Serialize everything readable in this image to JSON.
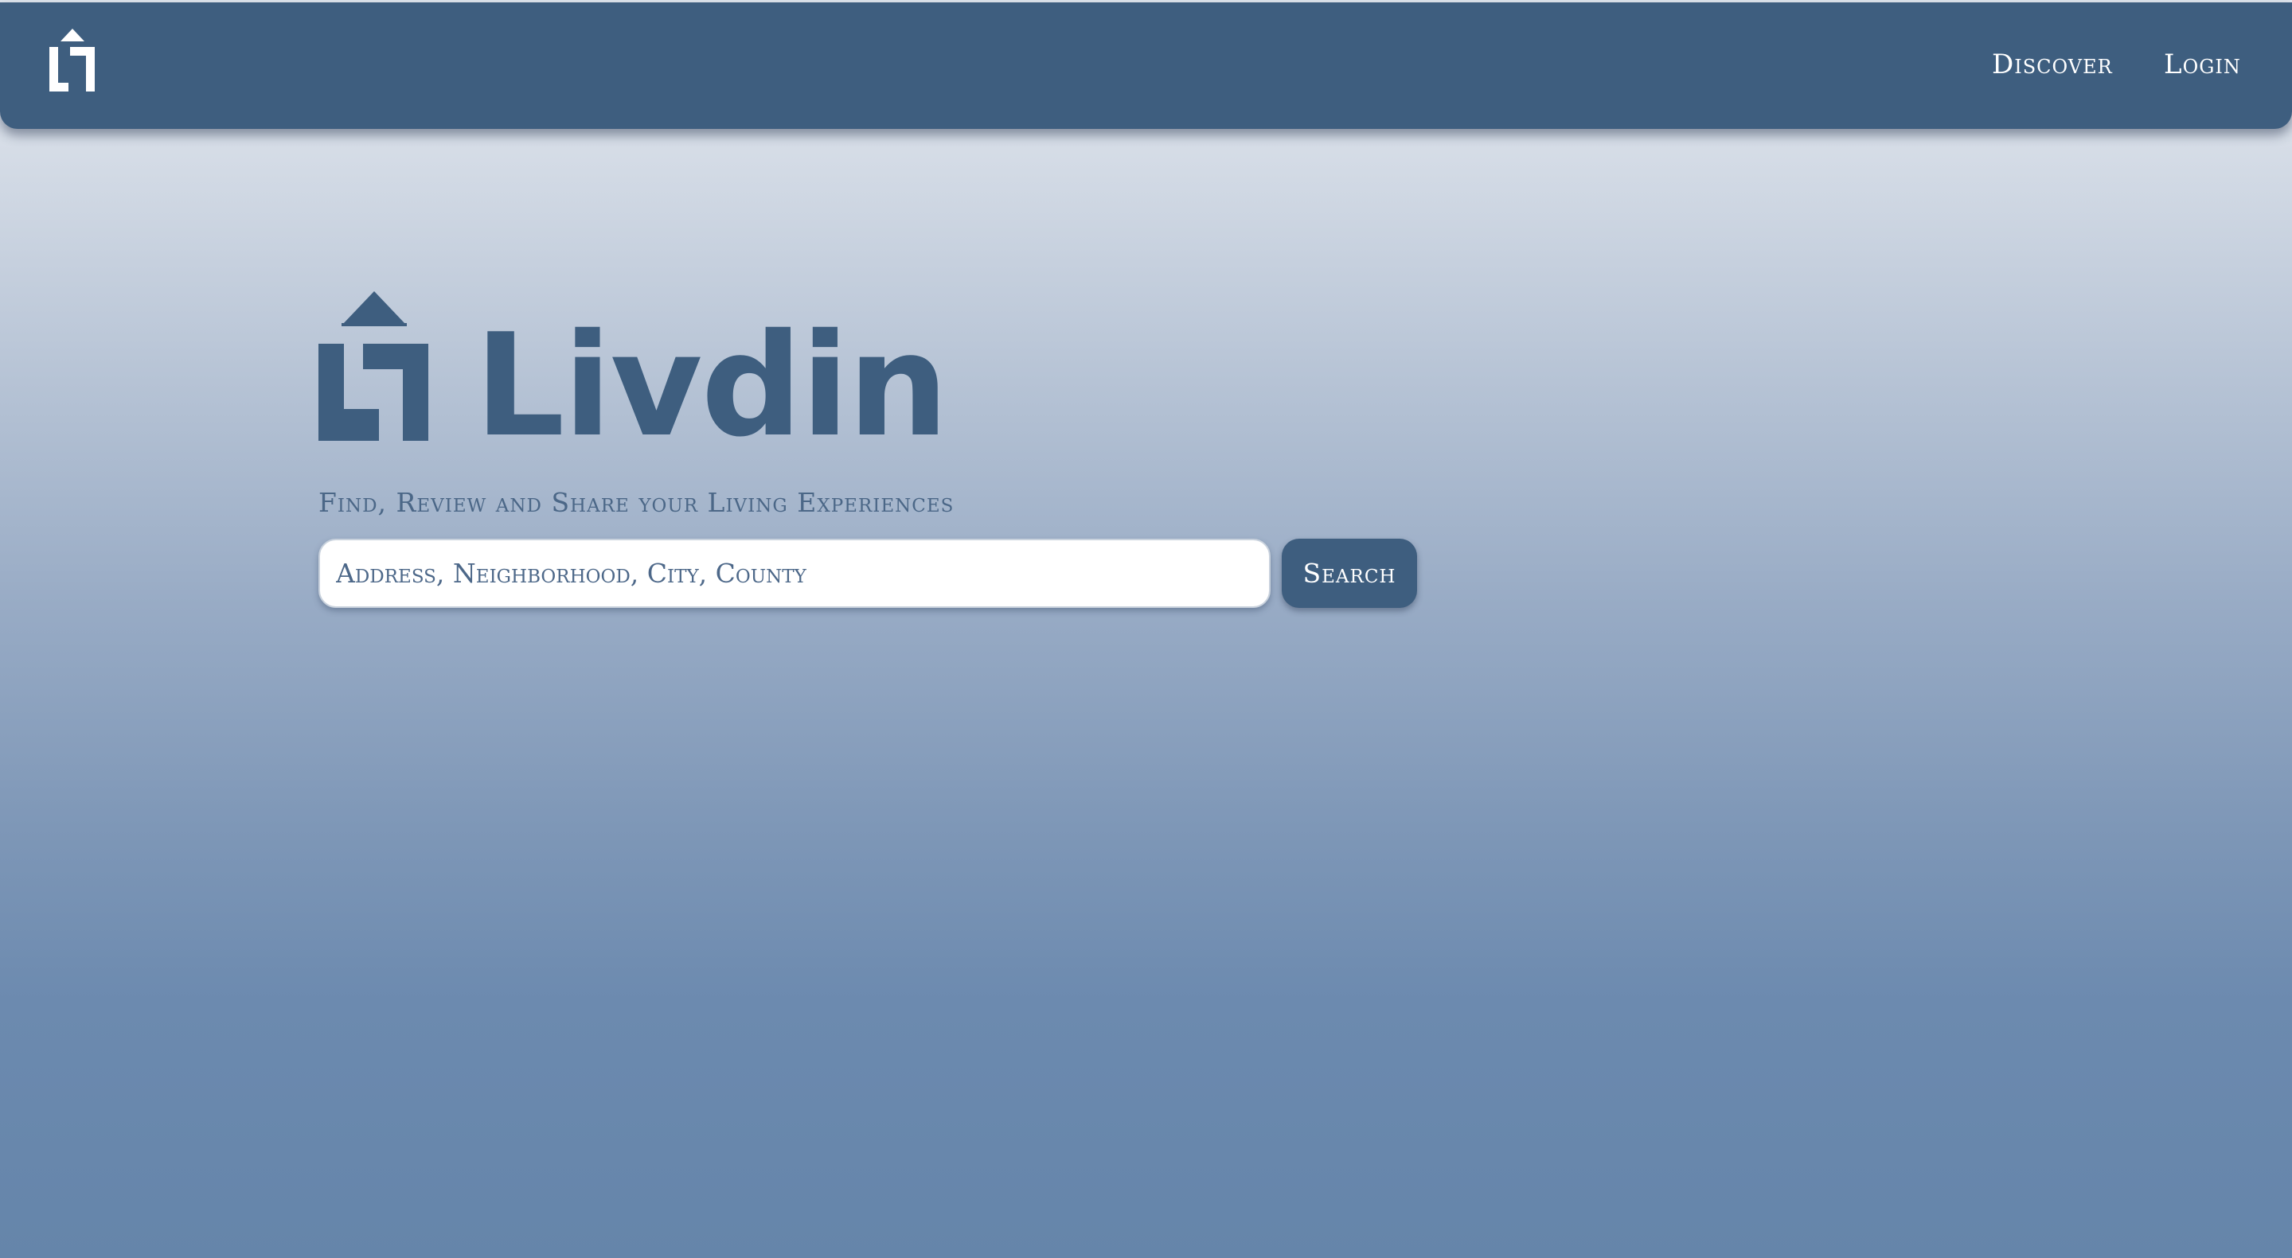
{
  "app": {
    "brand_name": "Livdin",
    "logo_icon": "livdin-house-arrow-logo",
    "colors": {
      "primary": "#3e5e7f",
      "nav_text": "#ffffff",
      "background_top": "#dfe5ed",
      "background_bottom": "#6585aa"
    }
  },
  "nav": {
    "links": [
      {
        "label": "Discover"
      },
      {
        "label": "Login"
      }
    ]
  },
  "hero": {
    "brand_name": "Livdin",
    "tagline": "Find, Review and Share your Living Experiences"
  },
  "search": {
    "placeholder": "Address, Neighborhood, City, County",
    "value": "",
    "button_label": "Search"
  }
}
